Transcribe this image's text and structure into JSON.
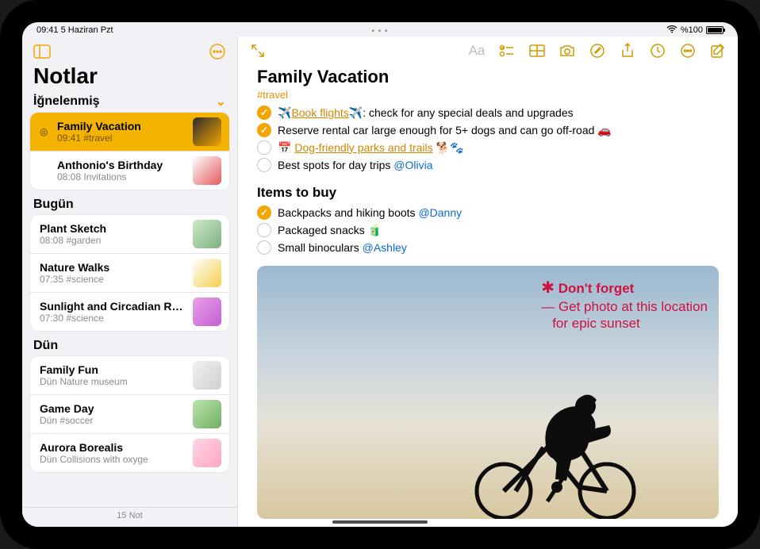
{
  "status": {
    "left": "09:41  5 Haziran Pzt",
    "battery": "%100",
    "wifi": "􀙇"
  },
  "sidebar": {
    "title": "Notlar",
    "footer": "15 Not",
    "sections": [
      {
        "head": "İğnelenmiş",
        "items": [
          {
            "title": "Family Vacation",
            "sub": "09:41  #travel",
            "pinned": true,
            "selected": true,
            "thumb": "linear-gradient(135deg,#2b2b2b,#f5a400)"
          },
          {
            "title": "Anthonio's Birthday",
            "sub": "08:08  Invitations",
            "pinned": false,
            "selected": false,
            "thumb": "linear-gradient(135deg,#fff,#e35b5b)"
          }
        ]
      },
      {
        "head": "Bugün",
        "items": [
          {
            "title": "Plant Sketch",
            "sub": "08:08  #garden",
            "thumb": "linear-gradient(135deg,#cfe9c9,#7bb080)"
          },
          {
            "title": "Nature Walks",
            "sub": "07:35  #science",
            "thumb": "linear-gradient(135deg,#fff,#f3cf4a)"
          },
          {
            "title": "Sunlight and Circadian Rhy…",
            "sub": "07:30  #science",
            "thumb": "linear-gradient(135deg,#e8a1e8,#c65ed4)"
          }
        ]
      },
      {
        "head": "Dün",
        "items": [
          {
            "title": "Family Fun",
            "sub": "Dün  Nature museum",
            "thumb": "linear-gradient(135deg,#f2f2f2,#cfcfcf)"
          },
          {
            "title": "Game Day",
            "sub": "Dün  #soccer",
            "thumb": "linear-gradient(135deg,#bde3b0,#6fb060)"
          },
          {
            "title": "Aurora Borealis",
            "sub": "Dün  Collisions with oxyge",
            "thumb": "linear-gradient(135deg,#ffd6e7,#ffa4c0)"
          }
        ]
      }
    ]
  },
  "note": {
    "title": "Family Vacation",
    "tag": "#travel",
    "list1": [
      {
        "checked": true,
        "pre": "✈️",
        "linkText": "Book flights",
        "post": "✈️: check for any special deals and upgrades"
      },
      {
        "checked": true,
        "text": "Reserve rental car large enough for 5+ dogs and can go off-road 🚗"
      },
      {
        "checked": false,
        "pre": "📅 ",
        "linkText": "Dog-friendly parks and trails",
        "post": " 🐕🐾"
      },
      {
        "checked": false,
        "text": "Best spots for day trips ",
        "mention": "@Olivia"
      }
    ],
    "h2": "Items to buy",
    "list2": [
      {
        "checked": true,
        "text": "Backpacks and hiking boots ",
        "mention": "@Danny"
      },
      {
        "checked": false,
        "text": "Packaged snacks 🧃"
      },
      {
        "checked": false,
        "text": "Small binoculars ",
        "mention": "@Ashley"
      }
    ],
    "handwriting": {
      "line1": "✱ Don't forget",
      "line2": "— Get photo at this location",
      "line3": "for epic sunset"
    }
  }
}
